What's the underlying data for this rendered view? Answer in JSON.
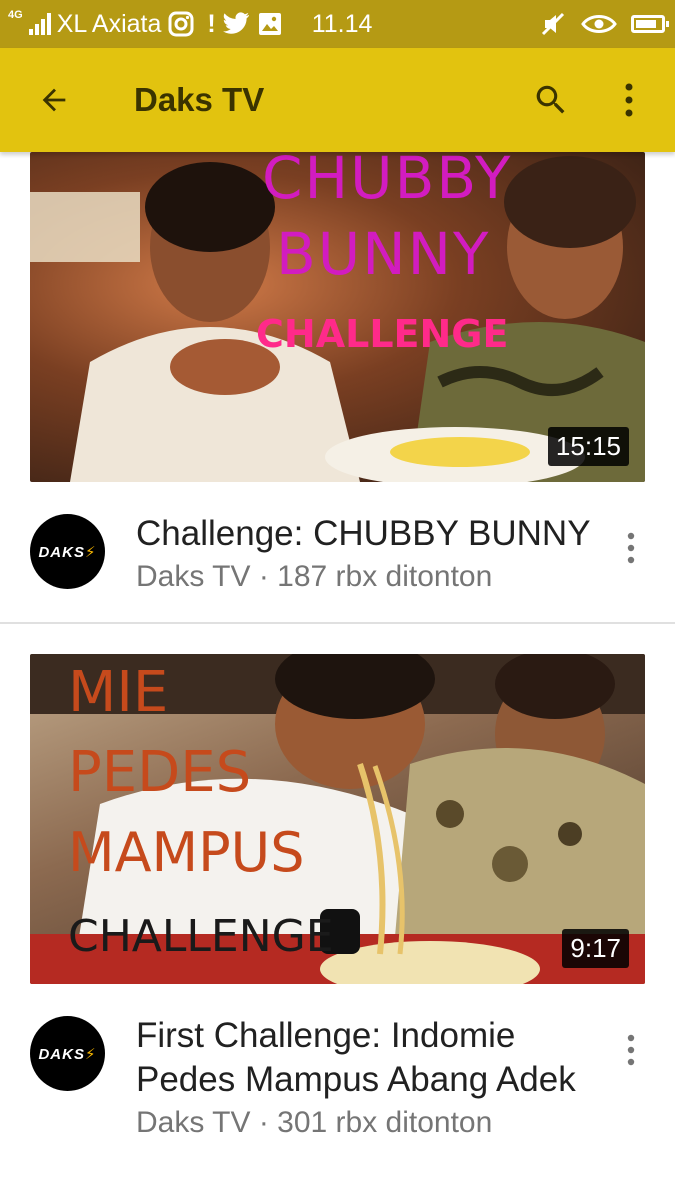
{
  "status_bar": {
    "network_type": "4G",
    "carrier": "XL Axiata",
    "notification_alert": "!",
    "time": "11.14",
    "icons": [
      "signal-icon",
      "instagram-icon",
      "twitter-icon",
      "gallery-icon",
      "mute-icon",
      "eye-icon",
      "battery-icon"
    ],
    "battery_level": 0.85
  },
  "app_bar": {
    "title": "Daks TV",
    "icons": [
      "back-arrow-icon",
      "search-icon",
      "more-vert-icon"
    ],
    "background_color": "#e2c30f"
  },
  "videos": [
    {
      "title": "Challenge: CHUBBY BUNNY",
      "subtitle": "Daks TV · 187 rbx ditonton",
      "duration": "15:15",
      "thumbnail_text": [
        "CHUBBY",
        "BUNNY",
        "CHALLENGE"
      ]
    },
    {
      "title": "First Challenge: Indomie Pedes Mampus Abang Adek",
      "subtitle": "Daks TV · 301 rbx ditonton",
      "duration": "9:17",
      "thumbnail_text": [
        "MIE",
        "PEDES",
        "MAMPUS",
        "CHALLENGE"
      ]
    }
  ],
  "channel_avatar": {
    "text": "DAKS",
    "bolt": "⚡"
  }
}
